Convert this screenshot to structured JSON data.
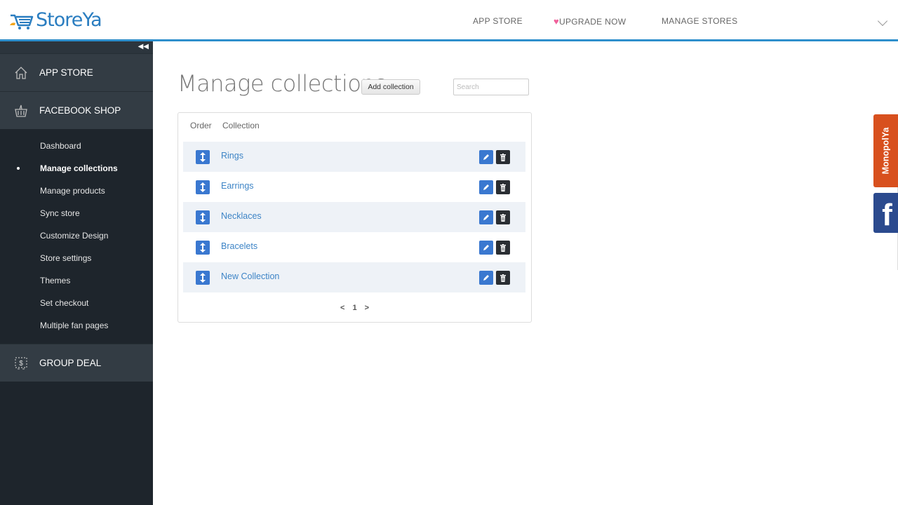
{
  "header": {
    "brand": "StoreYa",
    "nav": [
      {
        "label": "APP STORE",
        "icon": null
      },
      {
        "label": "UPGRADE NOW",
        "icon": "heart-icon"
      },
      {
        "label": "MANAGE STORES",
        "icon": null
      }
    ],
    "heart_glyph": "♥",
    "accent_color": "#2e8fcc"
  },
  "sidebar": {
    "collapse_glyph": "◀◀",
    "sections": [
      {
        "label": "APP STORE",
        "icon": "home-icon"
      },
      {
        "label": "FACEBOOK SHOP",
        "icon": "basket-icon"
      },
      {
        "label": "GROUP DEAL",
        "icon": "coupon-icon"
      }
    ],
    "sub_items": [
      {
        "label": "Dashboard",
        "active": false
      },
      {
        "label": "Manage collections",
        "active": true
      },
      {
        "label": "Manage products",
        "active": false
      },
      {
        "label": "Sync store",
        "active": false
      },
      {
        "label": "Customize Design",
        "active": false
      },
      {
        "label": "Store settings",
        "active": false
      },
      {
        "label": "Themes",
        "active": false
      },
      {
        "label": "Set checkout",
        "active": false
      },
      {
        "label": "Multiple fan pages",
        "active": false
      }
    ]
  },
  "main": {
    "title": "Manage collections",
    "add_button": "Add collection",
    "search_placeholder": "Search",
    "search_value": "",
    "table": {
      "columns": [
        "Order",
        "Collection"
      ],
      "rows": [
        {
          "name": "Rings"
        },
        {
          "name": "Earrings"
        },
        {
          "name": "Necklaces"
        },
        {
          "name": "Bracelets"
        },
        {
          "name": "New Collection"
        }
      ]
    },
    "pagination": {
      "prev": "<",
      "current": "1",
      "next": ">"
    }
  },
  "side_tabs": {
    "monopolya": "MonopolYa",
    "facebook": "f"
  }
}
